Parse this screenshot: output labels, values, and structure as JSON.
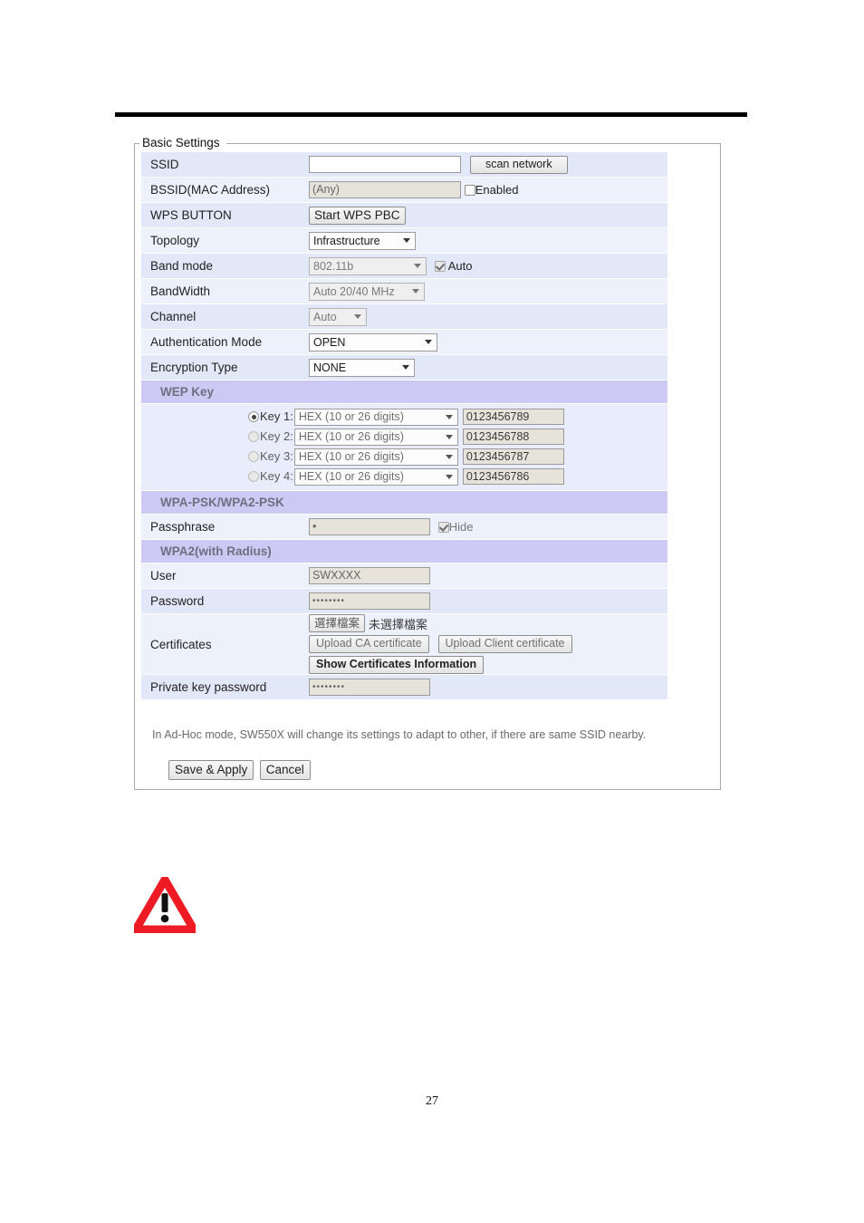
{
  "page": {
    "number": "27"
  },
  "fieldset": {
    "legend": "Basic Settings"
  },
  "rows": {
    "ssid": {
      "label": "SSID",
      "value": "",
      "scan_button": "scan network"
    },
    "bssid": {
      "label": "BSSID(MAC Address)",
      "value": "(Any)",
      "enabled_label": "Enabled"
    },
    "wps": {
      "label": "WPS BUTTON",
      "button": "Start WPS PBC"
    },
    "topology": {
      "label": "Topology",
      "value": "Infrastructure"
    },
    "band_mode": {
      "label": "Band mode",
      "value": "802.11b",
      "auto_label": "Auto"
    },
    "bandwidth": {
      "label": "BandWidth",
      "value": "Auto 20/40 MHz"
    },
    "channel": {
      "label": "Channel",
      "value": "Auto"
    },
    "auth_mode": {
      "label": "Authentication Mode",
      "value": "OPEN"
    },
    "encryption": {
      "label": "Encryption Type",
      "value": "NONE"
    }
  },
  "wep": {
    "section_title": "WEP Key",
    "keys": [
      {
        "label": "Key 1:",
        "format": "HEX (10 or 26 digits)",
        "value": "0123456789",
        "selected": true
      },
      {
        "label": "Key 2:",
        "format": "HEX (10 or 26 digits)",
        "value": "0123456788",
        "selected": false
      },
      {
        "label": "Key 3:",
        "format": "HEX (10 or 26 digits)",
        "value": "0123456787",
        "selected": false
      },
      {
        "label": "Key 4:",
        "format": "HEX (10 or 26 digits)",
        "value": "0123456786",
        "selected": false
      }
    ]
  },
  "wpa_psk": {
    "section_title": "WPA-PSK/WPA2-PSK",
    "passphrase_label": "Passphrase",
    "passphrase_value": "•",
    "hide_label": "Hide"
  },
  "wpa2_radius": {
    "section_title": "WPA2(with Radius)",
    "user_label": "User",
    "user_value": "SWXXXX",
    "password_label": "Password",
    "password_value": "••••••••",
    "certificates_label": "Certificates",
    "choose_file_button": "選擇檔案",
    "no_file_chosen": "未選擇檔案",
    "upload_ca_button": "Upload CA certificate",
    "upload_client_button": "Upload Client certificate",
    "show_certificates_button": "Show Certificates Information",
    "private_key_label": "Private key password",
    "private_key_value": "••••••••"
  },
  "footnote": "In Ad-Hoc mode, SW550X will change its settings to adapt to other, if there are same SSID nearby.",
  "actions": {
    "save": "Save & Apply",
    "cancel": "Cancel"
  },
  "colors": {
    "section_band": "#cdc9f5",
    "row_odd": "#e2e8f8",
    "row_even": "#edf1fc",
    "warning_red": "#ee1b24"
  }
}
